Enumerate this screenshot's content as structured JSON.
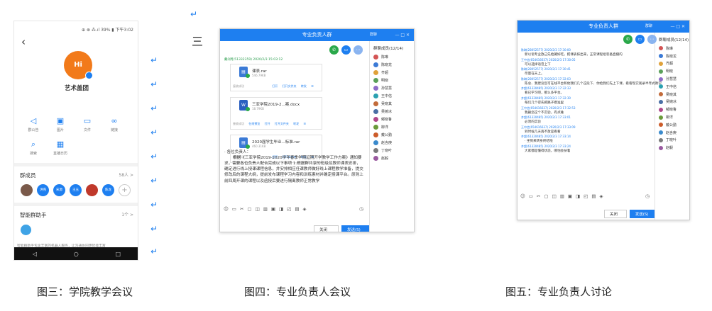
{
  "colors": {
    "accent": "#1e7ff0",
    "group_avatar": "#f27a1a",
    "ok": "#2aa84a"
  },
  "captions": [
    "图三：学院教学会议",
    "图四：专业负责人会议",
    "图五：专业负责人讨论"
  ],
  "arrow_glyph": "↵",
  "menu_glyph": "三",
  "fig3": {
    "status": "⊕ ⊗ ⁂.ıl 39% ▮ 下午3:02",
    "back_icon": "‹",
    "avatar_text": "Hi",
    "group_name": "艺术盖团",
    "tools": [
      {
        "icon": "speaker-icon",
        "glyph": "◁",
        "label": "群公告"
      },
      {
        "icon": "image-icon",
        "glyph": "▣",
        "label": "图片"
      },
      {
        "icon": "folder-icon",
        "glyph": "▭",
        "label": "文件"
      },
      {
        "icon": "link-icon",
        "glyph": "∞",
        "label": "链接"
      }
    ],
    "tools2": [
      {
        "icon": "search-icon",
        "glyph": "⌕",
        "label": "搜索"
      },
      {
        "icon": "calendar-icon",
        "glyph": "▦",
        "label": "直播日历"
      }
    ],
    "members_title": "群成员",
    "members_count": "58人 >",
    "members": [
      {
        "name": "",
        "color": "#7a5a4a"
      },
      {
        "name": "洪燕",
        "color": "#1e7ff0"
      },
      {
        "name": "宋源",
        "color": "#1e7ff0"
      },
      {
        "name": "王玉",
        "color": "#1e7ff0"
      },
      {
        "name": "",
        "color": "#c0392b"
      },
      {
        "name": "陈龙",
        "color": "#1e7ff0"
      }
    ],
    "add_glyph": "+",
    "assistant_title": "智能群助手",
    "assistant_count": "1个 >",
    "note": "智能群助手包含丰富的机器人服务，让沟通协同更智能丰富",
    "nav": [
      "◁",
      "○",
      "□"
    ]
  },
  "fig4": {
    "title": "专业负责人群",
    "title_more": "群聊",
    "title_controls": "—  □  ✕",
    "header_meta": "戴Q周(51332359) 2020/2/3 15:03:12",
    "files": [
      {
        "name": "课表.rar",
        "size": "546.79KB",
        "type": "zip",
        "color": "#3b7ad6",
        "glyph": "▤",
        "status": "接收成功",
        "actions": [
          "打开",
          "打开文件夹",
          "转发",
          "☰"
        ]
      },
      {
        "name": "三亚学院2019-2...案.docx",
        "size": "18.79KB",
        "type": "doc",
        "color": "#2b5fc0",
        "glyph": "W",
        "status": "接收成功",
        "actions": [
          "打开",
          "打开文件夹",
          "转发",
          "☰"
        ]
      },
      {
        "name": "2020届学生毕业...标准.rar",
        "size": "460.31KB",
        "type": "zip",
        "color": "#3b7ad6",
        "glyph": "▤",
        "status": "接收成功",
        "actions": [
          "打开",
          "打开文件夹",
          "转发",
          "☰"
        ]
      }
    ],
    "online_preview": "在线预览",
    "notice_greeting": "· 各位负责人：",
    "notice_body": "根据《三亚学院2019-2020学年春季学期延期开学教学工作方案》通知要求，需要各位负责人配合完成以下事项 1.根据群共享的班级及教师课表安排，确定进行线上授课课程信息，并安排相应任课教师做好线上课程教学准备，提交修改后的课程大纲，提前发布课程学习内容和训练素材并确定授课平台。原则上前四周开课的课程以及函授后要进行隔离教师正常教学",
    "member_header": "群聊成员(12/14)",
    "members": [
      "陈琳",
      "陈晓龙",
      "齐超",
      "明晓",
      "孙慧慧",
      "王中信",
      "吴晓其",
      "吴婉冰",
      "郁晓鲁",
      "柳洋",
      "戴公勤",
      "赵含庚",
      "丁晓叶",
      "赵毅"
    ],
    "tools": [
      "☺",
      "▭",
      "✂",
      "▢",
      "◫",
      "▥",
      "▣",
      "◨",
      "◰",
      "▤",
      "◈"
    ],
    "clock": "◷",
    "close_label": "关闭(C)",
    "send_label": "发送(S)",
    "send_arrow": "▾"
  },
  "fig5": {
    "title": "专业负责人群",
    "title_more": "群聊",
    "title_controls": "—  □  ✕",
    "member_header": "群聊成员(12/14)",
    "members": [
      "陈琳",
      "陈晓龙",
      "齐超",
      "明晓",
      "孙慧慧",
      "王中信",
      "吴晓其",
      "吴婉冰",
      "郁晓鲁",
      "柳洋",
      "戴公勤",
      "赵含庚",
      "丁晓叶",
      "赵毅"
    ],
    "messages": [
      {
        "head": "陈琳(28052577) 2020/2/3 17:30:00",
        "body": "新以语专业放己先给藏好吃，把课表排出来，正常课程组装备直播的"
      },
      {
        "head": "王中信(654616637) 2020/2/3 17:30:05",
        "body": "可以选择语音上下"
      },
      {
        "head": "陈琳(28052577) 2020/2/3 17:30:41",
        "body": "尽量在天上。"
      },
      {
        "head": "陈琳(28052577) 2020/2/3 17:32:03",
        "body": "陈总、我建议您可在线平台和他我们几个这段下、你给我们先上下课，看看现实观录半年式教学"
      },
      {
        "head": "齐超(61320485) 2020/2/3 17:32:33",
        "body": "看已学习吧，那么多平台。"
      },
      {
        "head": "齐超(61320485) 2020/2/3 17:32:39",
        "body": "每们几个得先把路子摸准里"
      },
      {
        "head": "王中信(654616637) 2020/2/3 17:32:53",
        "body": "我删您这个不实验，有点难"
      },
      {
        "head": "齐超(61320485) 2020/2/3 17:33:01",
        "body": "必须的实验"
      },
      {
        "head": "王中信(654616637) 2020/2/3 17:33:09",
        "body": "到时候几天再不放是看看"
      },
      {
        "head": "齐超(61320485) 2020/2/3 17:33:14",
        "body": "· 坐到来转身终哈啦"
      },
      {
        "head": "齐超(61320485) 2020/2/3 17:33:24",
        "body": "大家都是懂得状态，哪怕会扶着"
      }
    ],
    "tools": [
      "☺",
      "▭",
      "✂",
      "▢",
      "◫",
      "▥",
      "▣",
      "◨",
      "◰",
      "▤",
      "◈"
    ],
    "clock": "◷",
    "close_label": "关闭(C)",
    "send_label": "发送(S)",
    "send_arrow": "▾"
  }
}
